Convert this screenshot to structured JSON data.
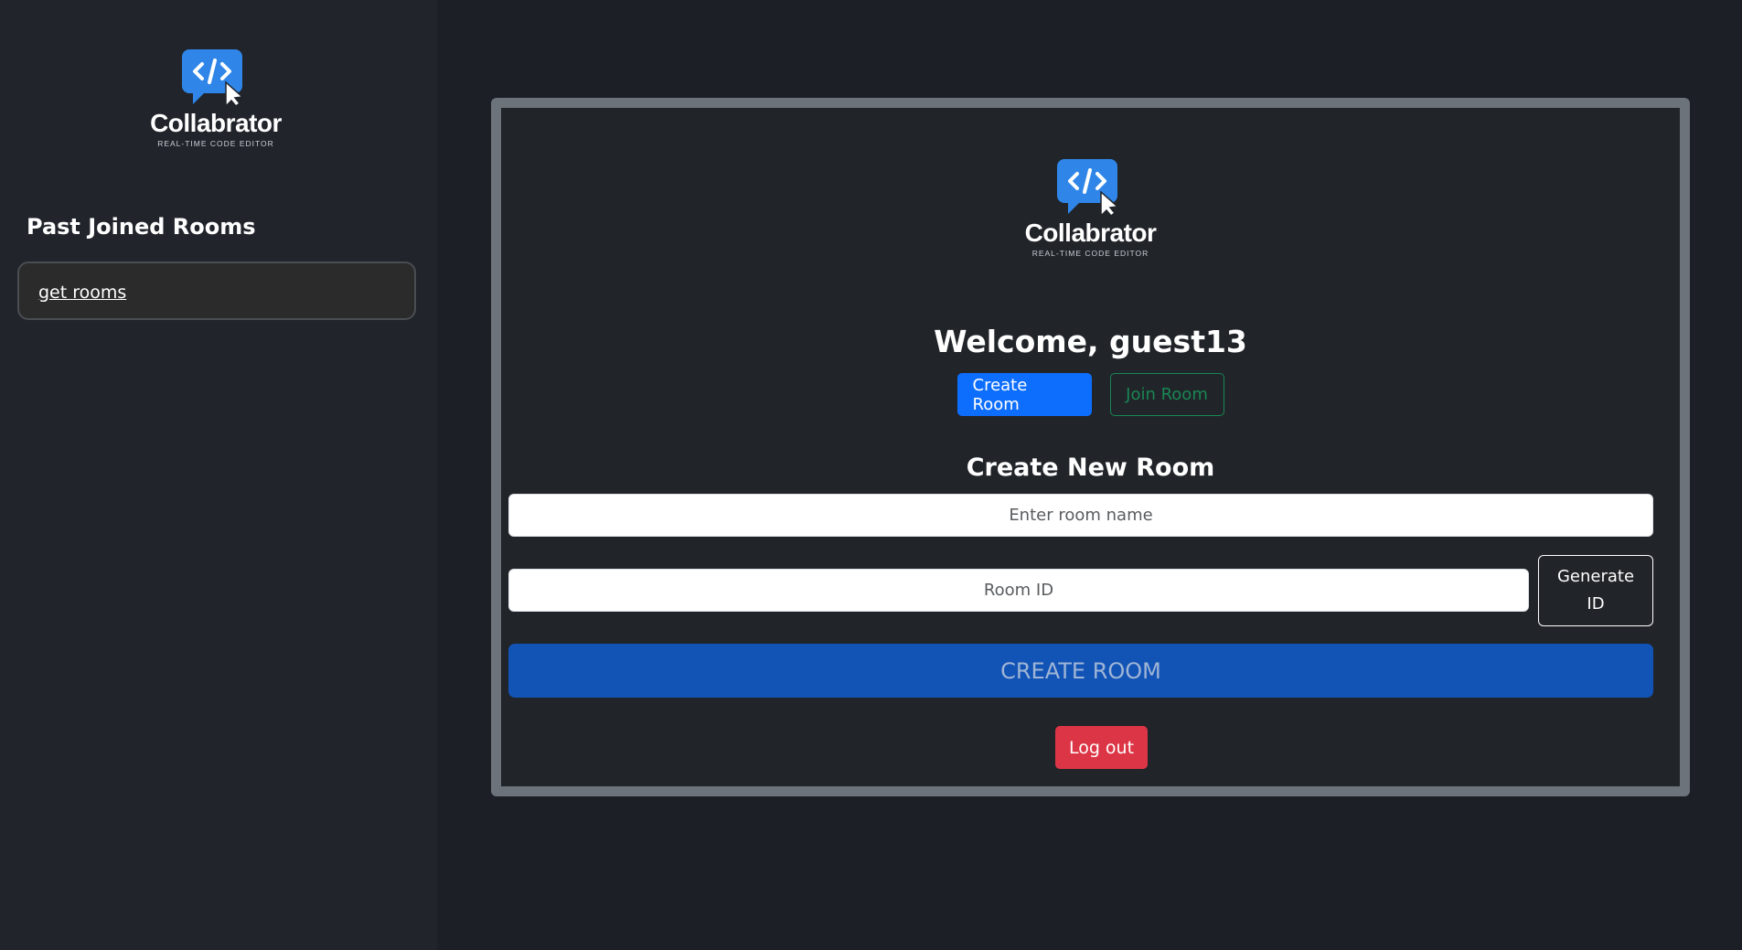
{
  "brand": {
    "name": "Collabrator",
    "tagline": "REAL-TIME CODE EDITOR",
    "icon_glyph": "</>",
    "color": "#2f86e8"
  },
  "sidebar": {
    "title": "Past Joined Rooms",
    "rooms_link": "get rooms"
  },
  "main": {
    "welcome": "Welcome, guest13",
    "tabs": {
      "create_label": "Create Room",
      "join_label": "Join Room"
    },
    "section_title": "Create New Room",
    "room_name": {
      "placeholder": "Enter room name",
      "value": ""
    },
    "room_id": {
      "placeholder": "Room ID",
      "value": ""
    },
    "generate_label": "Generate ID",
    "create_button_label": "CREATE ROOM",
    "logout_label": "Log out"
  },
  "colors": {
    "primary": "#0d6efd",
    "success": "#198754",
    "danger": "#dc3545",
    "create_button": "#1253b6",
    "card_border": "#6c737b"
  }
}
